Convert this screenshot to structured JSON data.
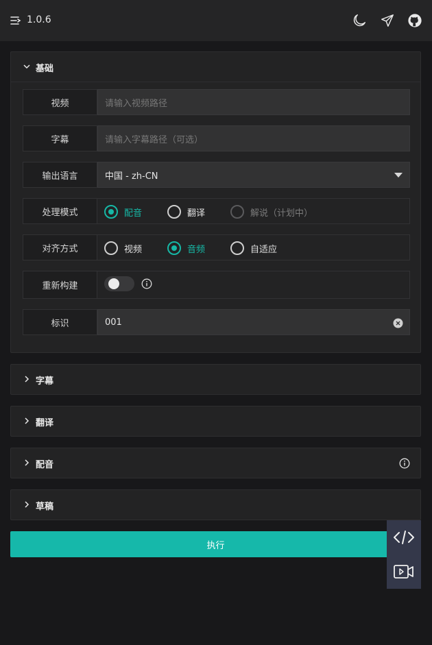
{
  "header": {
    "version": "1.0.6",
    "icons": [
      "menu-icon",
      "moon-icon",
      "send-icon",
      "github-icon"
    ]
  },
  "basic_panel": {
    "title": "基础",
    "rows": {
      "video": {
        "label": "视频",
        "placeholder": "请输入视频路径"
      },
      "subtitle": {
        "label": "字幕",
        "placeholder": "请输入字幕路径（可选）"
      },
      "output_lang": {
        "label": "输出语言",
        "value": "中国 - zh-CN"
      },
      "mode": {
        "label": "处理模式",
        "options": [
          "配音",
          "翻译",
          "解说（计划中）"
        ],
        "selected": "配音",
        "disabled": "解说（计划中）"
      },
      "align": {
        "label": "对齐方式",
        "options": [
          "视频",
          "音频",
          "自适应"
        ],
        "selected": "音频"
      },
      "rebuild": {
        "label": "重新构建",
        "enabled": false
      },
      "id": {
        "label": "标识",
        "value": "001"
      }
    }
  },
  "panels": [
    "字幕",
    "翻译",
    "配音",
    "草稿"
  ],
  "actions": {
    "execute": "执行"
  },
  "colors": {
    "accent": "#16b8aa",
    "background": "#18181a",
    "panel": "#232324",
    "float_button": "#34384a"
  }
}
